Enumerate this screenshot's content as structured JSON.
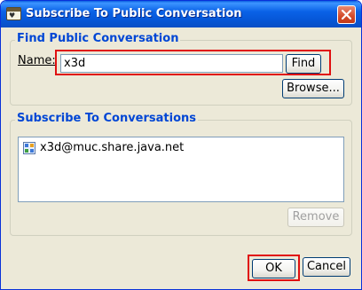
{
  "window": {
    "title": "Subscribe To Public Conversation"
  },
  "find_group": {
    "legend": "Find Public Conversation",
    "name_label": "Name:",
    "name_value": "x3d",
    "find_button": "Find",
    "browse_button": "Browse..."
  },
  "subscribe_group": {
    "legend": "Subscribe To Conversations",
    "items": [
      {
        "label": "x3d@muc.share.java.net",
        "icon": "conversation-icon"
      }
    ],
    "remove_button": "Remove"
  },
  "footer": {
    "ok_button": "OK",
    "cancel_button": "Cancel"
  },
  "colors": {
    "titlebar": "#0a62e7",
    "legend": "#0046d5",
    "highlight": "#e01010",
    "dialog_bg": "#ece9d8"
  }
}
